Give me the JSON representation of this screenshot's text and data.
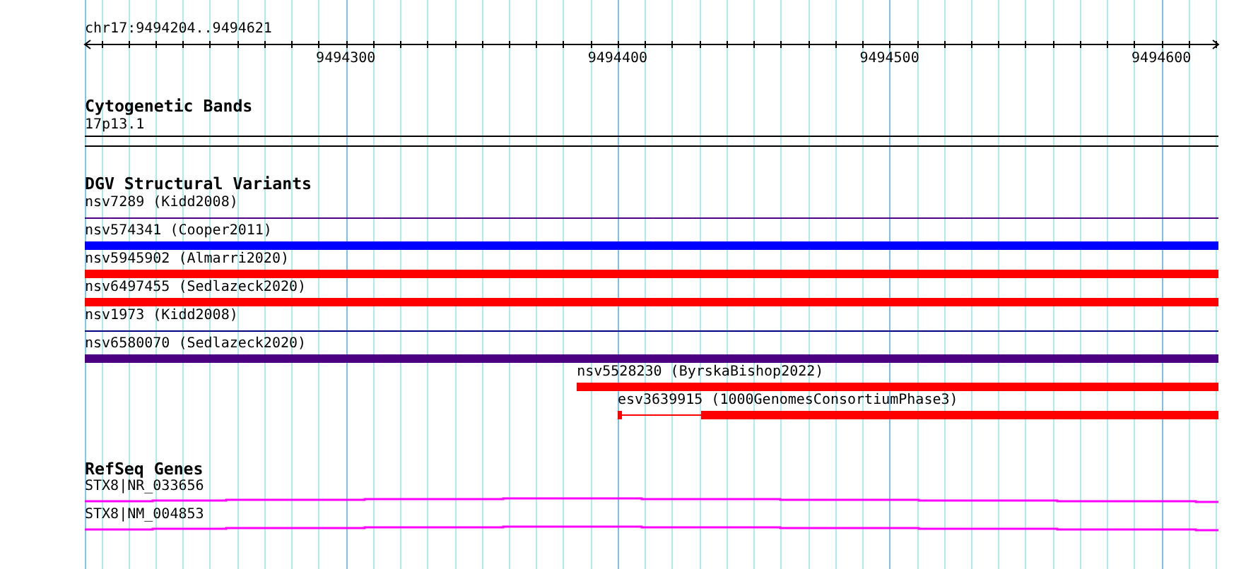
{
  "ruler": {
    "label": "chr17:9494204..9494621",
    "tick_labels": [
      "9494300",
      "9494400",
      "9494500",
      "9494600"
    ]
  },
  "tracks": [
    {
      "title": "Cytogenetic Bands",
      "features": [
        {
          "label": "17p13.1",
          "kind": "band"
        }
      ]
    },
    {
      "title": "DGV Structural Variants",
      "features": [
        {
          "label": "nsv7289 (Kidd2008)",
          "kind": "line",
          "color": "#4b0082"
        },
        {
          "label": "nsv574341 (Cooper2011)",
          "kind": "bar",
          "color": "#0000ff"
        },
        {
          "label": "nsv5945902 (Almarri2020)",
          "kind": "bar",
          "color": "#ff0000"
        },
        {
          "label": "nsv6497455 (Sedlazeck2020)",
          "kind": "bar",
          "color": "#ff0000"
        },
        {
          "label": "nsv1973 (Kidd2008)",
          "kind": "line",
          "color": "#000080"
        },
        {
          "label": "nsv6580070 (Sedlazeck2020)",
          "kind": "bar",
          "color": "#4b0082"
        },
        {
          "label": "nsv5528230 (ByrskaBishop2022)",
          "kind": "bar",
          "color": "#ff0000"
        },
        {
          "label": "esv3639915 (1000GenomesConsortiumPhase3)",
          "kind": "gapped",
          "color": "#ff0000"
        }
      ]
    },
    {
      "title": "RefSeq Genes",
      "features": [
        {
          "label": "STX8|NR_033656",
          "kind": "gene",
          "color": "#ff00ff"
        },
        {
          "label": "STX8|NM_004853",
          "kind": "gene",
          "color": "#ff00ff"
        }
      ]
    }
  ]
}
